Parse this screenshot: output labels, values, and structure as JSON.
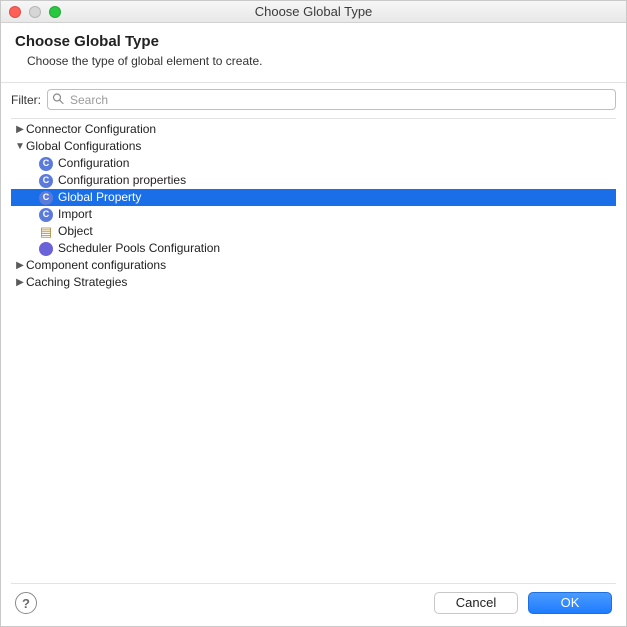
{
  "titlebar": {
    "title": "Choose Global Type"
  },
  "header": {
    "title": "Choose Global Type",
    "subtitle": "Choose the type of global element to create."
  },
  "filter": {
    "label": "Filter:",
    "placeholder": "Search"
  },
  "tree": {
    "connector": {
      "label": "Connector Configuration"
    },
    "global": {
      "label": "Global Configurations",
      "children": {
        "configuration": "Configuration",
        "configProps": "Configuration properties",
        "globalProperty": "Global Property",
        "import": "Import",
        "object": "Object",
        "scheduler": "Scheduler Pools Configuration"
      }
    },
    "component": {
      "label": "Component configurations"
    },
    "caching": {
      "label": "Caching Strategies"
    }
  },
  "footer": {
    "help": "?",
    "cancel": "Cancel",
    "ok": "OK"
  }
}
